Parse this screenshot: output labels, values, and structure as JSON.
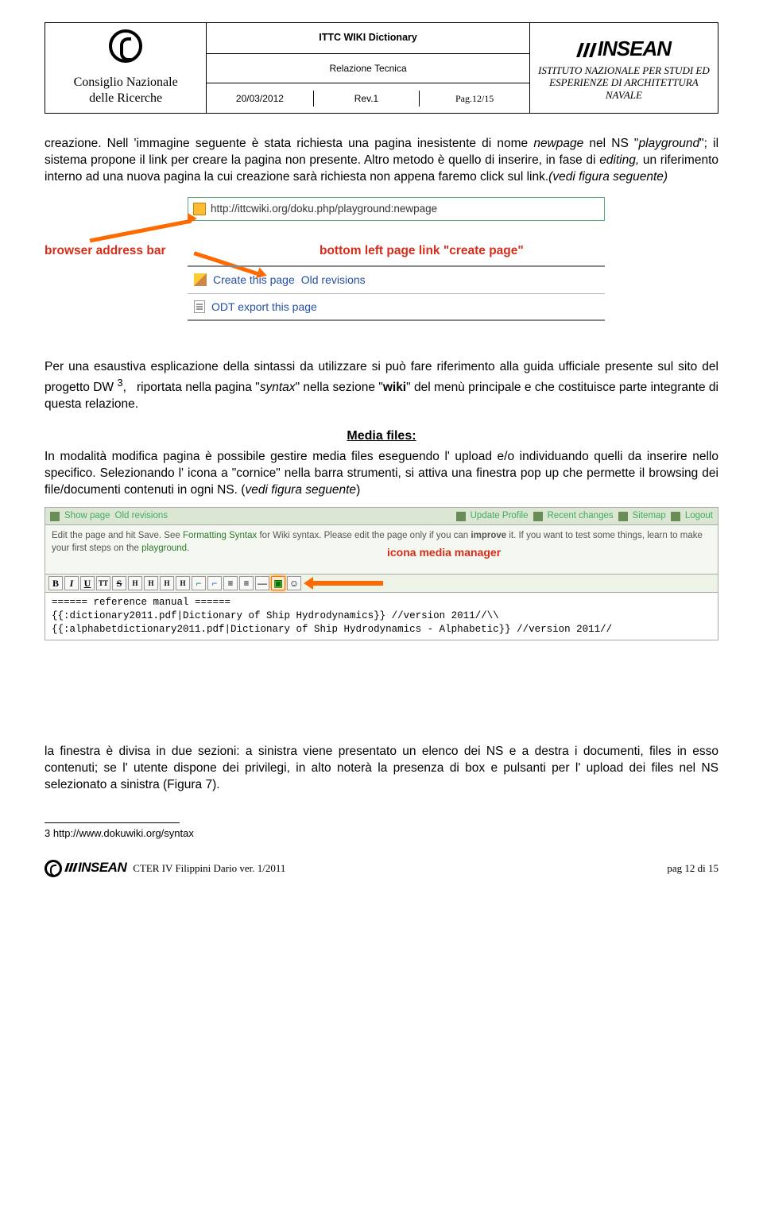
{
  "header": {
    "cnr_name": "Consiglio Nazionale\ndelle Ricerche",
    "doc_title": "ITTC WIKI Dictionary",
    "relazione": "Relazione Tecnica",
    "date": "20/03/2012",
    "rev": "Rev.1",
    "pag": "Pag.12/15",
    "insean_brand": "INSEAN",
    "insean_desc": "ISTITUTO NAZIONALE PER STUDI ED ESPERIENZE DI ARCHITETTURA NAVALE"
  },
  "para1": "creazione. Nell 'immagine seguente è stata richiesta una pagina inesistente di nome newpage nel NS \"playground\"; il sistema propone il link per creare la pagina non presente. Altro metodo è quello di inserire, in fase di editing, un riferimento interno ad una nuova pagina la cui creazione sarà richiesta non appena faremo click sul link.(vedi figura seguente)",
  "fig1": {
    "address": "http://ittcwiki.org/doku.php/playground:newpage",
    "label_left": "browser address bar",
    "label_right": "bottom left page link \"create page\"",
    "link_create": "Create this page",
    "link_oldrev": "Old revisions",
    "link_odt": "ODT export this page"
  },
  "para2": "Per una esaustiva esplicazione della sintassi da utilizzare si può fare riferimento alla guida ufficiale presente sul sito del progetto DW ³,   riportata nella pagina \"syntax\" nella sezione \"wiki\" del menù principale e che costituisce parte integrante di questa relazione.",
  "media_heading": "Media files:",
  "para3": "In modalità modifica pagina è possibile gestire media files eseguendo l' upload e/o individuando quelli da inserire nello specifico. Selezionando l' icona a \"cornice\" nella barra strumenti, si attiva una finestra pop up che permette il browsing dei file/documenti contenuti in ogni NS. (vedi figura seguente)",
  "fig2": {
    "topbar": {
      "show": "Show page",
      "oldrev": "Old revisions",
      "update": "Update Profile",
      "recent": "Recent changes",
      "sitemap": "Sitemap",
      "logout": "Logout"
    },
    "desc_pre": "Edit the page and hit Save. See ",
    "desc_link": "Formatting Syntax",
    "desc_mid": " for Wiki syntax. Please edit the page only if you can ",
    "desc_bold": "improve",
    "desc_post": " it. If you want to test some things, learn to make your first steps on the ",
    "desc_playground": "playground",
    "annotation": "icona media manager",
    "toolbar": [
      "B",
      "I",
      "U",
      "TT",
      "S",
      "H",
      "H",
      "H",
      "H",
      "⌐",
      "⌐",
      "⌐",
      "≡",
      "—",
      "🖼",
      "☺"
    ],
    "editor_line1": "====== reference manual ======",
    "editor_line2": "{{:dictionary2011.pdf|Dictionary of Ship Hydrodynamics}} //version 2011//\\\\",
    "editor_line3": "{{:alphabetdictionary2011.pdf|Dictionary of Ship Hydrodynamics - Alphabetic}} //version 2011//"
  },
  "para4": "la finestra è divisa in due sezioni: a sinistra viene presentato un elenco dei NS e a destra i documenti, files in esso contenuti; se l' utente dispone dei privilegi, in alto  noterà la presenza di box e pulsanti per l' upload dei files nel NS selezionato a sinistra (Figura 7).",
  "footnote": "3  http://www.dokuwiki.org/syntax",
  "footer": {
    "insean": "INSEAN",
    "text": "CTER IV Filippini Dario   ver. 1/2011",
    "pag": "pag 12 di 15"
  }
}
